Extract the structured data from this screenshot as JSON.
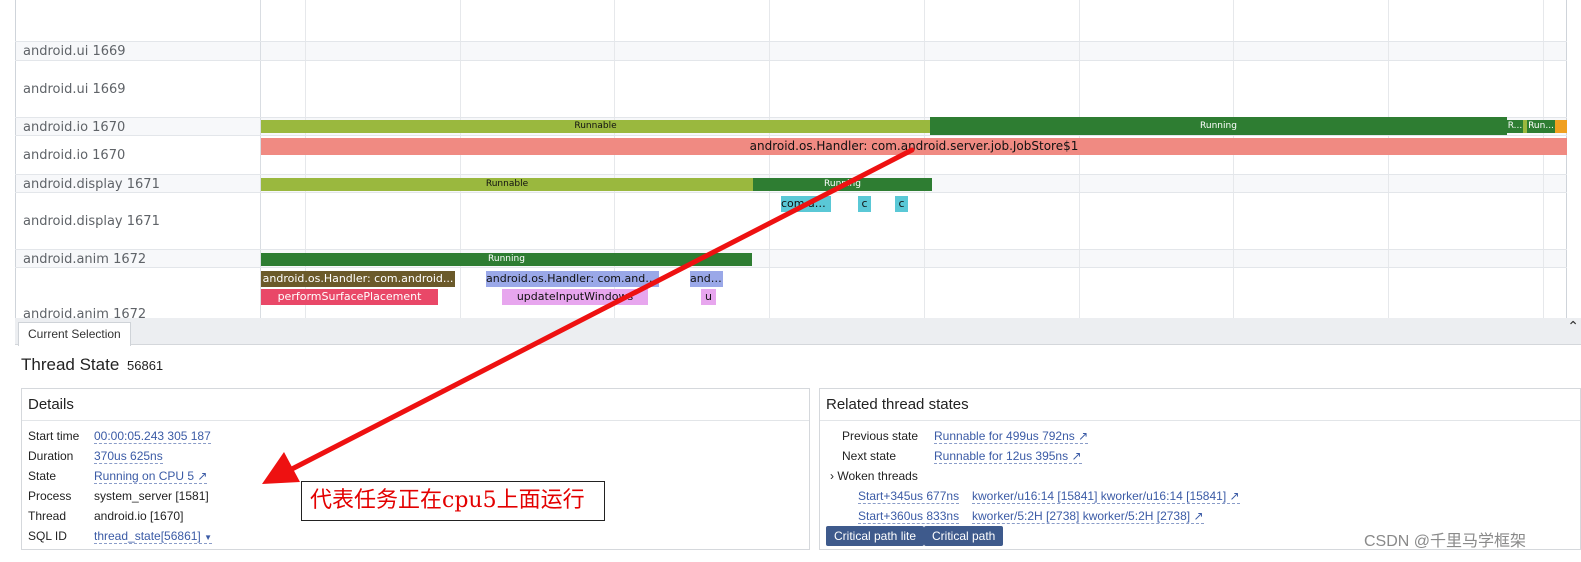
{
  "tracks": [
    {
      "label": "android.ui 1669"
    },
    {
      "label": "android.ui 1669"
    },
    {
      "label": "android.io 1670"
    },
    {
      "label": "android.io 1670"
    },
    {
      "label": "android.display 1671"
    },
    {
      "label": "android.display 1671"
    },
    {
      "label": "android.anim 1672"
    },
    {
      "label": "android.anim 1672"
    }
  ],
  "states": {
    "io_runnable": "Runnable",
    "io_running": "Running",
    "io_r_short": "R...",
    "io_run_short": "Run...",
    "display_runnable": "Runnable",
    "display_running": "Running",
    "anim_running": "Running"
  },
  "slices": {
    "io_handler": "android.os.Handler: com.android.server.job.JobStore$1",
    "display_com": "com.an...",
    "display_c1": "c",
    "display_c2": "c",
    "anim_handler1": "android.os.Handler: com.android...",
    "anim_handler2": "android.os.Handler: com.andr...",
    "anim_handler3": "andr...",
    "anim_perform": "performSurfacePlacement",
    "anim_update": "updateInputWindows",
    "anim_u": "u"
  },
  "colors": {
    "runnable": "#9ab83e",
    "running": "#2e7d32",
    "handler_io": "#f08a82",
    "cyan": "#5ac8d6",
    "olive": "#6b5a2a",
    "periwinkle": "#9aa8e8",
    "pink": "#e94868",
    "lilac": "#e7a6ee",
    "orange": "#f0a020",
    "arrow": "#ee1111"
  },
  "panel": {
    "tab": "Current Selection",
    "resize_glyph": "⌃",
    "title": "Thread State",
    "title_id": "56861",
    "details": {
      "heading": "Details",
      "start_time_label": "Start time",
      "start_time": "00:00:05.243 305 187",
      "duration_label": "Duration",
      "duration": "370us 625ns",
      "state_label": "State",
      "state": "Running on CPU 5",
      "process_label": "Process",
      "process": "system_server [1581]",
      "thread_label": "Thread",
      "thread": "android.io [1670]",
      "sqlid_label": "SQL ID",
      "sqlid": "thread_state[56861]"
    },
    "related": {
      "heading": "Related thread states",
      "prev_label": "Previous state",
      "prev": "Runnable for 499us 792ns",
      "next_label": "Next state",
      "next": "Runnable for 12us 395ns",
      "woken_label": "Woken threads",
      "woken": [
        {
          "time": "Start+345us 677ns",
          "thread": "kworker/u16:14 [15841] kworker/u16:14 [15841]"
        },
        {
          "time": "Start+360us 833ns",
          "thread": "kworker/5:2H [2738] kworker/5:2H [2738]"
        }
      ],
      "btn_lite": "Critical path lite",
      "btn_full": "Critical path"
    }
  },
  "annotation": "代表任务正在cpu5上面运行",
  "watermark": "CSDN @千里马学框架"
}
